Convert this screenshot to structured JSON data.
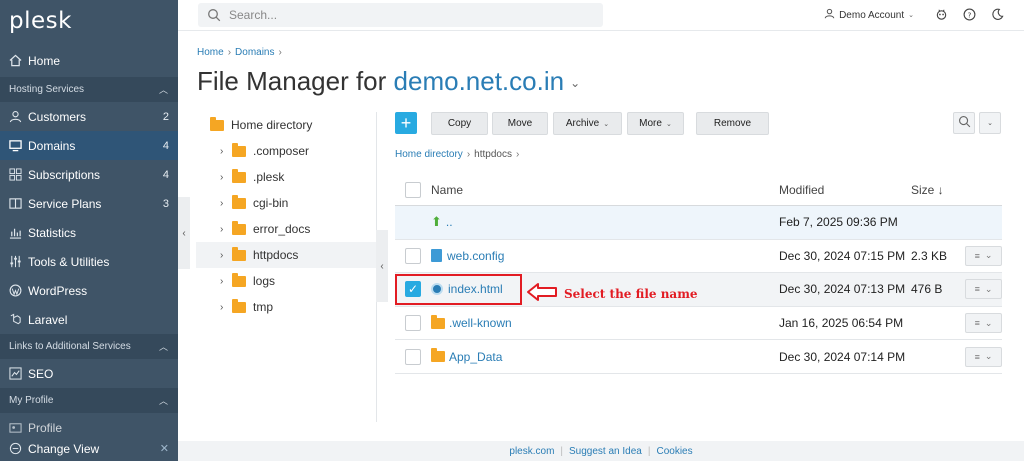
{
  "sidebar": {
    "logo": "plesk",
    "home": "Home",
    "hosting_section": "Hosting Services",
    "items": [
      {
        "label": "Customers",
        "count": "2"
      },
      {
        "label": "Domains",
        "count": "4"
      },
      {
        "label": "Subscriptions",
        "count": "4"
      },
      {
        "label": "Service Plans",
        "count": "3"
      },
      {
        "label": "Statistics",
        "count": ""
      },
      {
        "label": "Tools & Utilities",
        "count": ""
      },
      {
        "label": "WordPress",
        "count": ""
      },
      {
        "label": "Laravel",
        "count": ""
      }
    ],
    "links_section": "Links to Additional Services",
    "seo": "SEO",
    "profile_section": "My Profile",
    "profile": "Profile",
    "change_view": "Change View"
  },
  "topbar": {
    "search_placeholder": "Search...",
    "account": "Demo Account"
  },
  "breadcrumb": [
    "Home",
    "Domains"
  ],
  "title": {
    "prefix": "File Manager for ",
    "domain": "demo.net.co.in"
  },
  "tree": {
    "root": "Home directory",
    "children": [
      ".composer",
      ".plesk",
      "cgi-bin",
      "error_docs",
      "httpdocs",
      "logs",
      "tmp"
    ]
  },
  "toolbar": {
    "copy": "Copy",
    "move": "Move",
    "archive": "Archive",
    "more": "More",
    "remove": "Remove"
  },
  "path": {
    "root": "Home directory",
    "current": "httpdocs"
  },
  "table": {
    "headers": {
      "name": "Name",
      "modified": "Modified",
      "size": "Size ↓"
    },
    "rows": [
      {
        "name": "..",
        "modified": "Feb 7, 2025 09:36 PM",
        "size": ""
      },
      {
        "name": "web.config",
        "modified": "Dec 30, 2024 07:15 PM",
        "size": "2.3 KB"
      },
      {
        "name": "index.html",
        "modified": "Dec 30, 2024 07:13 PM",
        "size": "476 B"
      },
      {
        "name": ".well-known",
        "modified": "Jan 16, 2025 06:54 PM",
        "size": ""
      },
      {
        "name": "App_Data",
        "modified": "Dec 30, 2024 07:14 PM",
        "size": ""
      }
    ]
  },
  "annotation": "Select the file name",
  "footer": [
    "plesk.com",
    "Suggest an Idea",
    "Cookies"
  ],
  "colors": {
    "sidebar": "#3f5467",
    "accent": "#28aae1",
    "link": "#2a7db5",
    "highlight": "#e21c23"
  }
}
